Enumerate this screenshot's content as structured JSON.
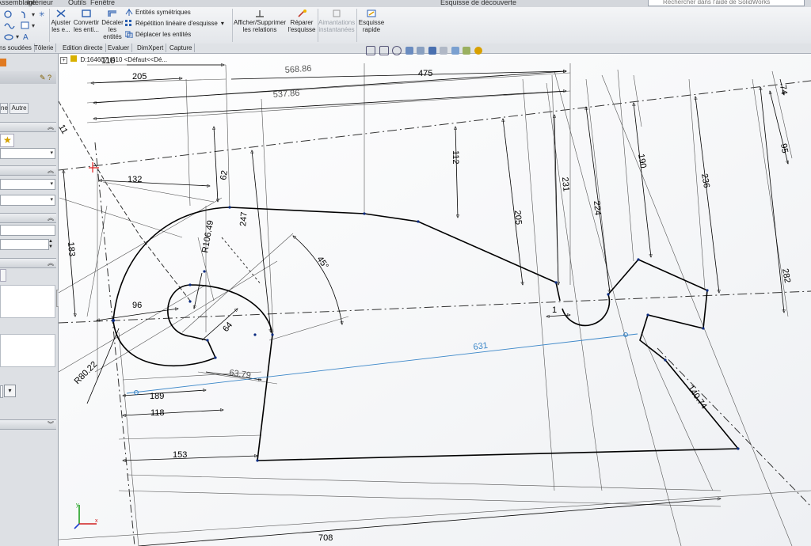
{
  "top": {
    "menu_partial": [
      "Assemblage",
      "Inférieur",
      "Outils",
      "Fenêtre"
    ],
    "window_title": "Esquisse de découverte",
    "search_placeholder": "Rechercher dans l'aide de SolidWorks"
  },
  "ribbon": {
    "ajuster_label": "Ajuster les e...",
    "convertir_label": "Convertir les enti...",
    "decaler_label": "Décaler les entités",
    "sym_label": "Entités symétriques",
    "rep_label": "Répétition linéaire d'esquisse",
    "depl_label": "Déplacer les entités",
    "relations_label": "Afficher/Supprimer les relations",
    "reparer_label": "Réparer l'esquisse",
    "aimant_label": "Aimantations instantanées",
    "rapide_label": "Esquisse rapide"
  },
  "tabs": [
    "ns soudées",
    "Tôlerie",
    "Edition directe",
    "Evaluer",
    "DimXpert",
    "Capture"
  ],
  "panel": {
    "tab_partial": "ne",
    "tab_autre": "Autre"
  },
  "tree": {
    "node_label": "D:164607 (410 <Défaut<<Dé..."
  },
  "colors": {
    "ribbon_bg": "#e8eaed",
    "panel_bg": "#dde0e4",
    "sketch_line": "#000000",
    "construction_line": "#333333",
    "driven_dimension": "#555555",
    "selected_dimension": "#3a86c8",
    "origin_red": "#e02020"
  },
  "dimensions": {
    "d205": "205",
    "d110": "110",
    "d568": "568.86",
    "d537": "537.86",
    "d475": "475",
    "d74": "74",
    "d11": "11",
    "d112": "112",
    "d95": "95",
    "d190": "190",
    "d132": "132",
    "d62": "62",
    "d231": "231",
    "d236": "236",
    "d247": "247",
    "d224": "224",
    "d205b": "205",
    "d183": "183",
    "dR106": "R106.49",
    "d45": "45°",
    "d282": "282",
    "d96": "96",
    "d64": "64",
    "d631": "631",
    "d1": "1",
    "dR80": "R80.22",
    "d6379": "63.79",
    "d189": "189",
    "d118": "118",
    "d14074": "140.74",
    "d153": "153",
    "d708": "708"
  }
}
